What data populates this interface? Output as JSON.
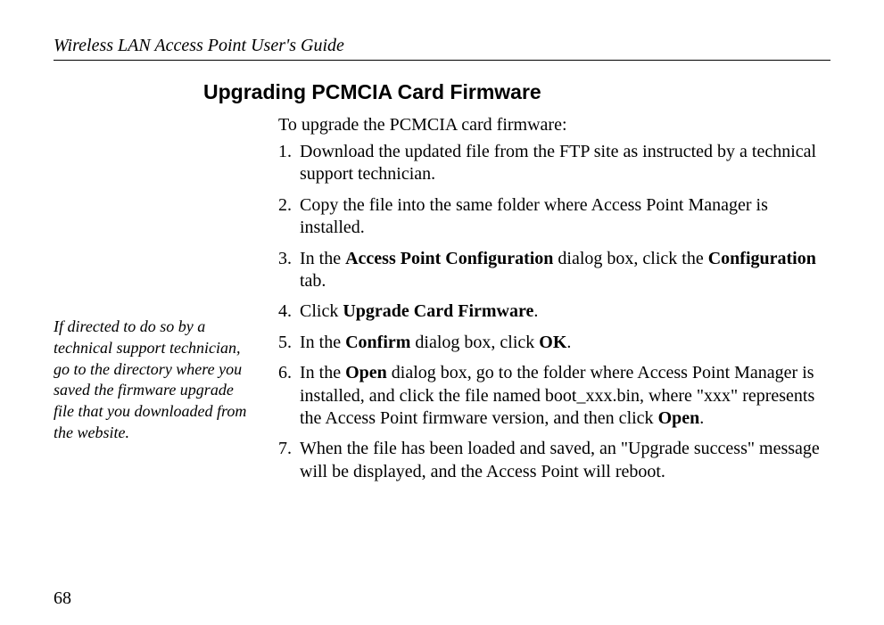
{
  "header": {
    "title": "Wireless LAN Access Point User's Guide"
  },
  "heading": "Upgrading PCMCIA Card Firmware",
  "intro": "To upgrade the PCMCIA card firmware:",
  "steps": {
    "n1": "1.",
    "t1a": "Download the updated file from the FTP site as instructed by a technical support technician.",
    "n2": "2.",
    "t2a": "Copy the file into the same folder where Access Point Manager is installed.",
    "n3": "3.",
    "t3a": "In the ",
    "t3b": "Access Point Configuration",
    "t3c": " dialog box, click the ",
    "t3d": "Configuration",
    "t3e": " tab.",
    "n4": "4.",
    "t4a": "Click ",
    "t4b": "Upgrade Card Firmware",
    "t4c": ".",
    "n5": "5.",
    "t5a": "In the ",
    "t5b": "Confirm",
    "t5c": " dialog box, click ",
    "t5d": "OK",
    "t5e": ".",
    "n6": "6.",
    "t6a": "In the ",
    "t6b": "Open",
    "t6c": " dialog box, go to the folder where Access Point Manager is installed, and click the file named boot_xxx.bin, where \"xxx\" represents the Access Point firmware version, and then click ",
    "t6d": "Open",
    "t6e": ".",
    "n7": "7.",
    "t7a": "When the file has been loaded and saved, an \"Upgrade success\" message will be displayed, and the Access Point will reboot."
  },
  "sidenote": "If directed to do so by a technical support technician, go to the directory where you saved the firmware upgrade file that you downloaded from the website.",
  "page_number": "68"
}
